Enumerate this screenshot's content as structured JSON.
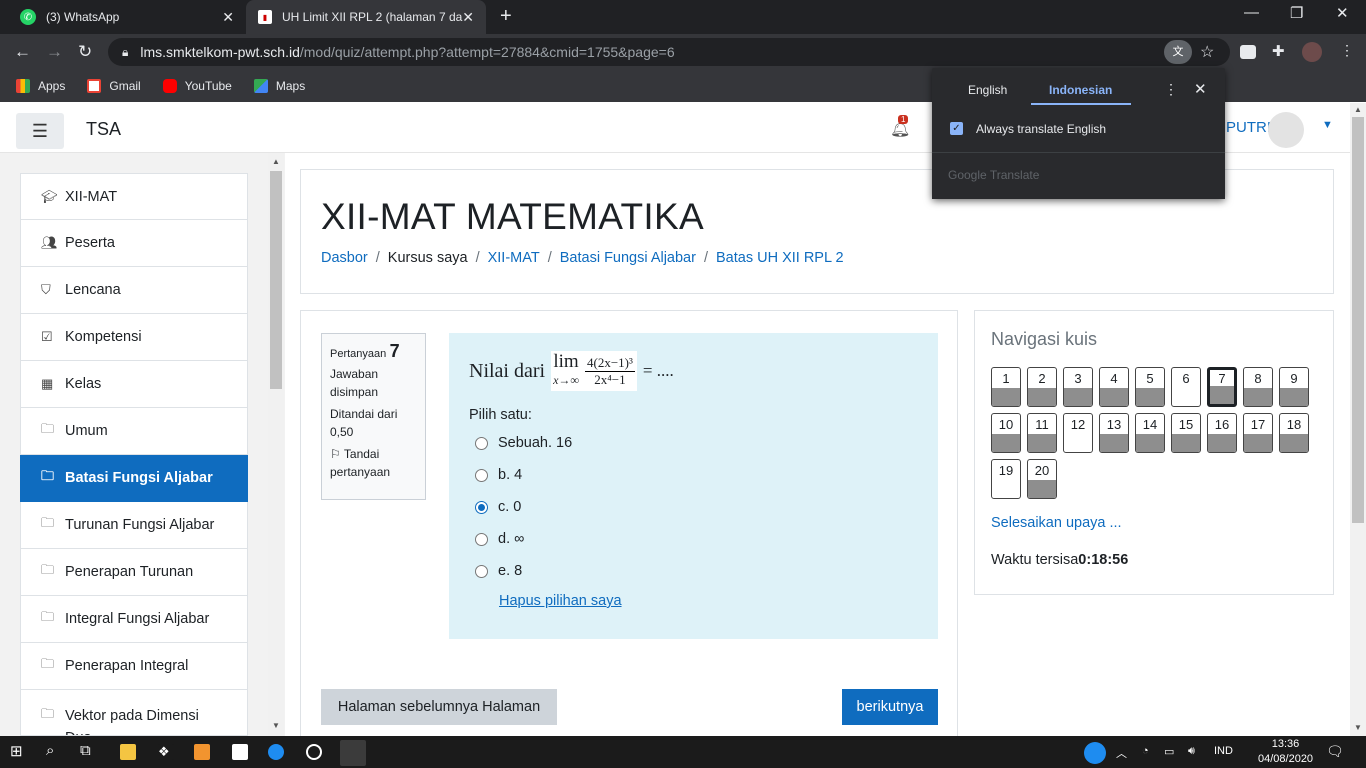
{
  "browser": {
    "tabs": [
      {
        "title": "(3) WhatsApp",
        "icon": "whatsapp-icon"
      },
      {
        "title": "UH Limit XII RPL 2 (halaman 7 da",
        "icon": "site-icon"
      }
    ],
    "url_host": "lms.smktelkom-pwt.sch.id",
    "url_path": "/mod/quiz/attempt.php?attempt=27884&cmid=1755&page=6",
    "bookmarks": [
      {
        "label": "Apps",
        "icon": "apps-icon"
      },
      {
        "label": "Gmail",
        "icon": "gmail-icon"
      },
      {
        "label": "YouTube",
        "icon": "youtube-icon"
      },
      {
        "label": "Maps",
        "icon": "maps-icon"
      }
    ]
  },
  "translate_popup": {
    "tab_english": "English",
    "tab_indonesian": "Indonesian",
    "always_label": "Always translate English",
    "footer": "Google Translate"
  },
  "header": {
    "site_name": "TSA",
    "notification_count": "1",
    "user_name": "PUTRI"
  },
  "sidebar": {
    "items": [
      {
        "label": "XII-MAT",
        "icon": "graduation-cap-icon"
      },
      {
        "label": "Peserta",
        "icon": "users-icon"
      },
      {
        "label": "Lencana",
        "icon": "shield-icon"
      },
      {
        "label": "Kompetensi",
        "icon": "checkbox-icon"
      },
      {
        "label": "Kelas",
        "icon": "table-icon"
      },
      {
        "label": "Umum",
        "icon": "folder-icon"
      },
      {
        "label": "Batasi Fungsi Aljabar",
        "icon": "folder-icon",
        "active": true
      },
      {
        "label": "Turunan Fungsi Aljabar",
        "icon": "folder-icon"
      },
      {
        "label": "Penerapan Turunan",
        "icon": "folder-icon"
      },
      {
        "label": "Integral Fungsi Aljabar",
        "icon": "folder-icon"
      },
      {
        "label": "Penerapan Integral",
        "icon": "folder-icon"
      },
      {
        "label": "Vektor pada Dimensi Dua",
        "icon": "folder-icon"
      }
    ]
  },
  "course": {
    "title": "XII-MAT MATEMATIKA",
    "breadcrumbs": [
      "Dasbor",
      "Kursus saya",
      "XII-MAT",
      "Batasi Fungsi Aljabar",
      "Batas UH XII RPL 2"
    ]
  },
  "question": {
    "label": "Pertanyaan",
    "number": "7",
    "status": "Jawaban disimpan",
    "marks": "Ditandai dari 0,50",
    "flag": "Tandai pertanyaan",
    "text_prefix": "Nilai dari",
    "math_lim": "lim",
    "math_sub": "x→∞",
    "math_num": "4(2x−1)³",
    "math_den": "2x⁴−1",
    "text_suffix": "= ....",
    "choose_label": "Pilih satu:",
    "options": [
      "Sebuah. 16",
      "b. 4",
      "c. 0",
      "d. ∞",
      "e. 8"
    ],
    "selected_index": 2,
    "clear_label": "Hapus pilihan saya",
    "prev_button": "Halaman sebelumnya Halaman",
    "next_button": "berikutnya"
  },
  "quiz_nav": {
    "title": "Navigasi kuis",
    "questions": [
      {
        "n": "1",
        "answered": true
      },
      {
        "n": "2",
        "answered": true
      },
      {
        "n": "3",
        "answered": true
      },
      {
        "n": "4",
        "answered": true
      },
      {
        "n": "5",
        "answered": true
      },
      {
        "n": "6",
        "answered": false
      },
      {
        "n": "7",
        "answered": true,
        "current": true
      },
      {
        "n": "8",
        "answered": true
      },
      {
        "n": "9",
        "answered": true
      },
      {
        "n": "10",
        "answered": true
      },
      {
        "n": "11",
        "answered": true
      },
      {
        "n": "12",
        "answered": false
      },
      {
        "n": "13",
        "answered": true
      },
      {
        "n": "14",
        "answered": true
      },
      {
        "n": "15",
        "answered": true
      },
      {
        "n": "16",
        "answered": true
      },
      {
        "n": "17",
        "answered": true
      },
      {
        "n": "18",
        "answered": true
      },
      {
        "n": "19",
        "answered": false
      },
      {
        "n": "20",
        "answered": true
      }
    ],
    "finish_label": "Selesaikan upaya ...",
    "timer_label": "Waktu tersisa",
    "timer_value": "0:18:56"
  },
  "taskbar": {
    "lang": "IND",
    "time": "13:36",
    "date": "04/08/2020"
  }
}
